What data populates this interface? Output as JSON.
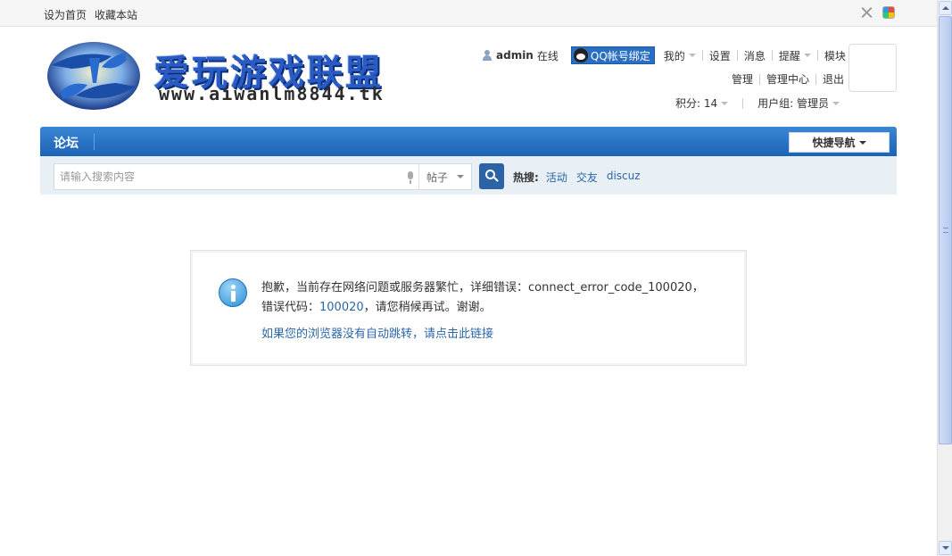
{
  "topbar": {
    "links": [
      "设为首页",
      "收藏本站"
    ],
    "icons": [
      "fullscreen-icon",
      "style-switch-icon"
    ]
  },
  "logo": {
    "title": "爱玩游戏联盟",
    "url": "www.aiwanlm8844.tk",
    "colors": {
      "primary": "#2a5bc4",
      "shadow": "#0c2f7a"
    }
  },
  "user": {
    "name": "admin",
    "status": "在线",
    "qq_bind": "QQ帐号绑定",
    "menu1": [
      "我的",
      "设置",
      "消息",
      "提醒",
      "模块"
    ],
    "menu2": [
      "管理",
      "管理中心",
      "退出"
    ],
    "points": "积分: 14",
    "group": "用户组: 管理员"
  },
  "nav": {
    "forum": "论坛",
    "quick_nav": "快捷导航",
    "color": "#1b63b6"
  },
  "search": {
    "placeholder": "请输入搜索内容",
    "type": "帖子",
    "hot_label": "热搜:",
    "hot_links": [
      "活动",
      "交友",
      "discuz"
    ]
  },
  "message": {
    "line1": "抱歉，当前存在网络问题或服务器繁忙，详细错误：connect_error_code_100020，",
    "line2_prefix": "错误代码：",
    "line2_code": "100020",
    "line2_suffix": "，请您稍候再试。谢谢。",
    "redirect_link": "如果您的浏览器没有自动跳转，请点击此链接"
  }
}
